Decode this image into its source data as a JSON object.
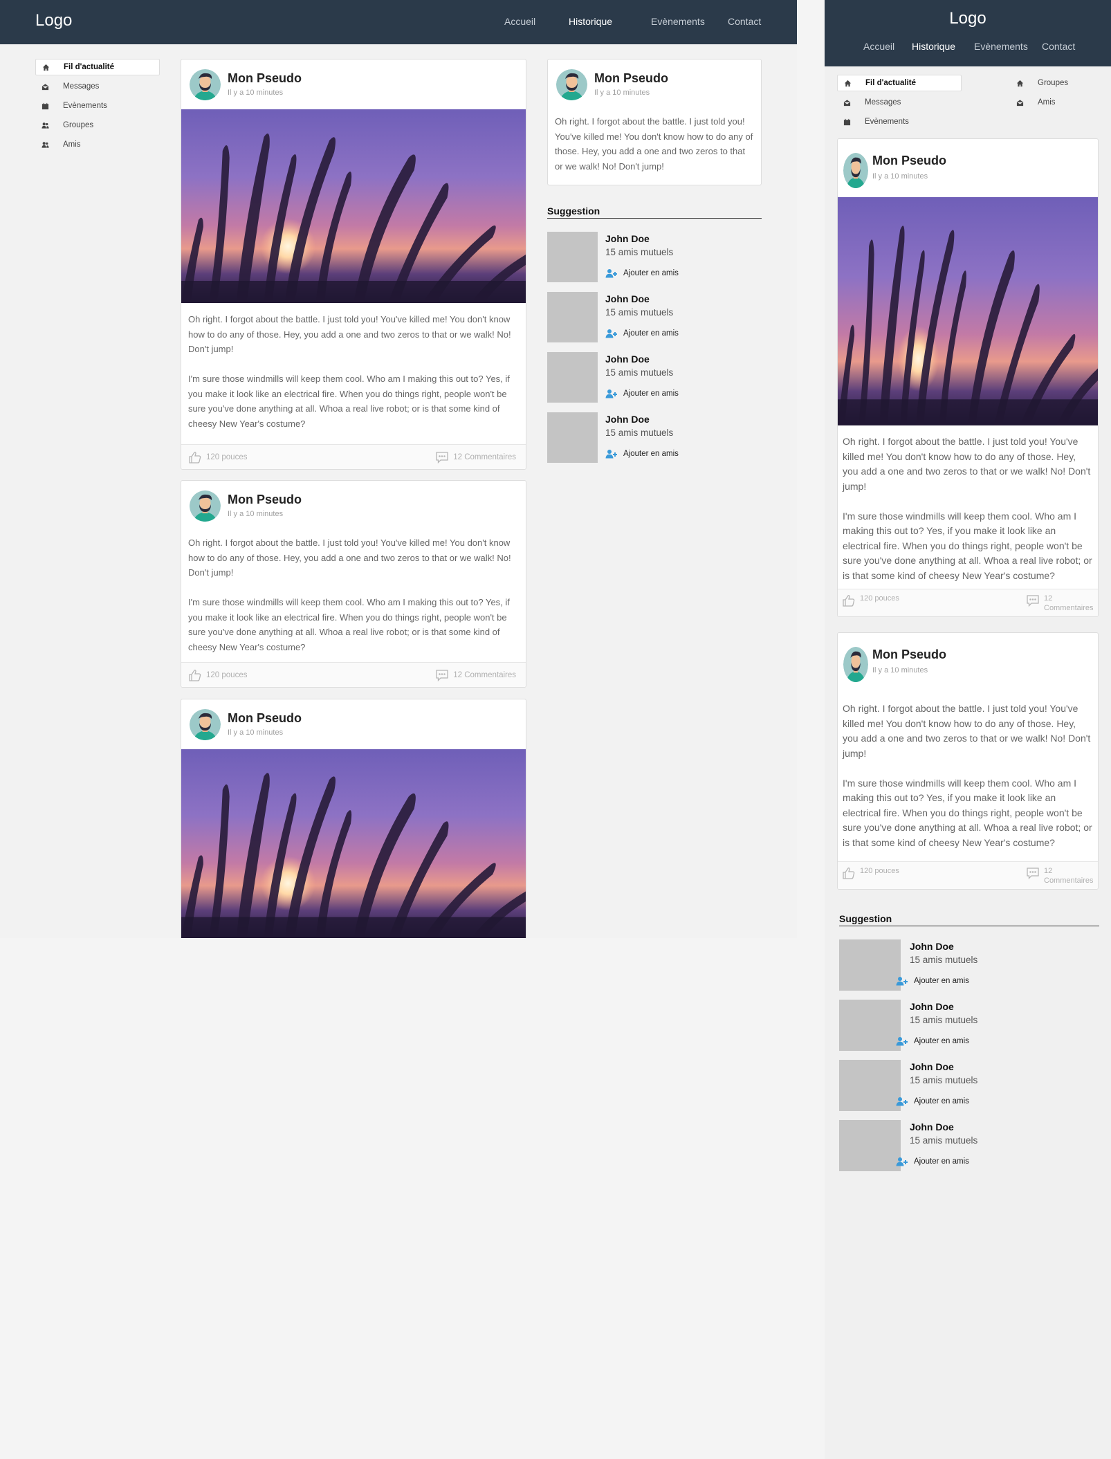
{
  "desktop": {
    "logo": "Logo",
    "nav": [
      "Accueil",
      "Historique",
      "Evènements",
      "Contact"
    ],
    "sidebar": [
      {
        "label": "Fil d'actualité",
        "icon": "home-icon"
      },
      {
        "label": "Messages",
        "icon": "envelope-icon"
      },
      {
        "label": "Evènements",
        "icon": "calendar-icon"
      },
      {
        "label": "Groupes",
        "icon": "users-icon"
      },
      {
        "label": "Amis",
        "icon": "users-icon"
      }
    ]
  },
  "mobile": {
    "logo": "Logo",
    "nav": [
      "Accueil",
      "Historique",
      "Evènements",
      "Contact"
    ],
    "sidebar": [
      {
        "label": "Fil d'actualité",
        "icon": "home-icon"
      },
      {
        "label": "Messages",
        "icon": "envelope-icon"
      },
      {
        "label": "Evènements",
        "icon": "calendar-icon"
      },
      {
        "label": "Groupes",
        "icon": "home-icon"
      },
      {
        "label": "Amis",
        "icon": "envelope-icon"
      }
    ]
  },
  "post": {
    "pseudo": "Mon Pseudo",
    "time": "Il y a 10 minutes",
    "p1": "Oh right. I forgot about the battle. I just told you! You've killed me! You don't know how to do any of those. Hey, you add a one and two zeros to that or we walk! No! Don't jump!",
    "p2": "I'm sure those windmills will keep them cool. Who am I making this out to? Yes, if you make it look like an electrical fire. When you do things right, people won't be sure you've done anything at all. Whoa a real live robot; or is that some kind of cheesy New Year's costume?",
    "likes": "120 pouces",
    "comments": "12 Commentaires"
  },
  "suggestion": {
    "title": "Suggestion",
    "people": [
      {
        "name": "John Doe",
        "mutual": "15 amis mutuels",
        "action": "Ajouter en amis"
      },
      {
        "name": "John Doe",
        "mutual": "15 amis mutuels",
        "action": "Ajouter en amis"
      },
      {
        "name": "John Doe",
        "mutual": "15 amis mutuels",
        "action": "Ajouter en amis"
      },
      {
        "name": "John Doe",
        "mutual": "15 amis mutuels",
        "action": "Ajouter en amis"
      }
    ]
  },
  "colors": {
    "header": "#2b3a4a",
    "accent": "#3a9ad9",
    "placeholder": "#c4c4c4"
  }
}
